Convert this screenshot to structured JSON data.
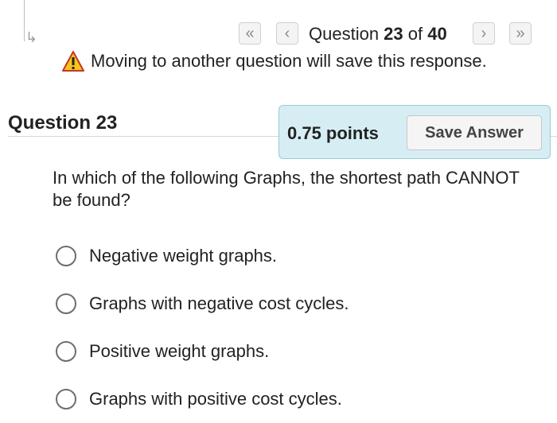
{
  "nav": {
    "first_icon": "«",
    "prev_icon": "‹",
    "next_icon": "›",
    "last_icon": "»",
    "prefix": "Question ",
    "current": "23",
    "mid": " of ",
    "total": "40"
  },
  "warning": {
    "icon": "warning-icon",
    "text": "Moving to another question will save this response."
  },
  "question": {
    "title": "Question 23",
    "points": "0.75 points",
    "save_label": "Save Answer",
    "text": "In which of the following Graphs, the shortest path CANNOT be found?"
  },
  "options": [
    {
      "label": "Negative weight graphs."
    },
    {
      "label": "Graphs with negative cost cycles."
    },
    {
      "label": "Positive weight graphs."
    },
    {
      "label": "Graphs with positive cost cycles."
    }
  ],
  "colors": {
    "points_box": "#d6eef3",
    "warning_yellow": "#f5c518",
    "warning_border": "#c0392b"
  }
}
